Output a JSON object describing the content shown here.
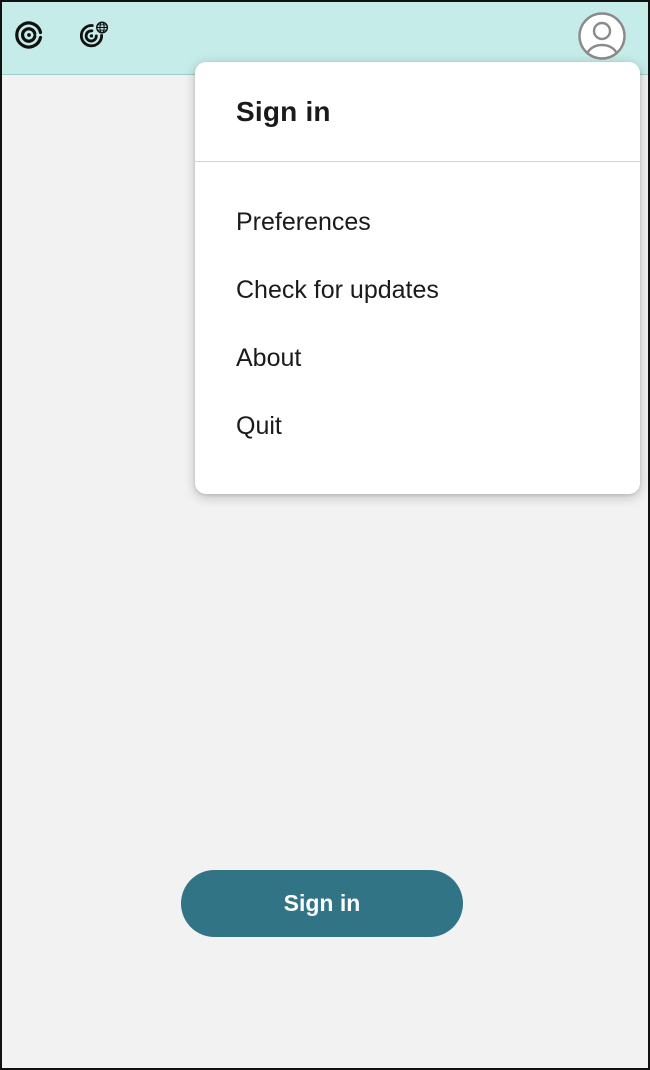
{
  "header": {
    "apps": [
      {
        "icon": "citrix-workspace-icon"
      },
      {
        "icon": "citrix-web-icon"
      }
    ],
    "account_icon": "user-avatar-icon"
  },
  "menu": {
    "title": "Sign in",
    "items": [
      {
        "label": "Preferences"
      },
      {
        "label": "Check for updates"
      },
      {
        "label": "About"
      },
      {
        "label": "Quit"
      }
    ]
  },
  "main": {
    "signin_button_label": "Sign in"
  },
  "colors": {
    "header_bg": "#c5ece9",
    "body_bg": "#f2f2f2",
    "button_bg": "#307486",
    "menu_bg": "#ffffff"
  }
}
